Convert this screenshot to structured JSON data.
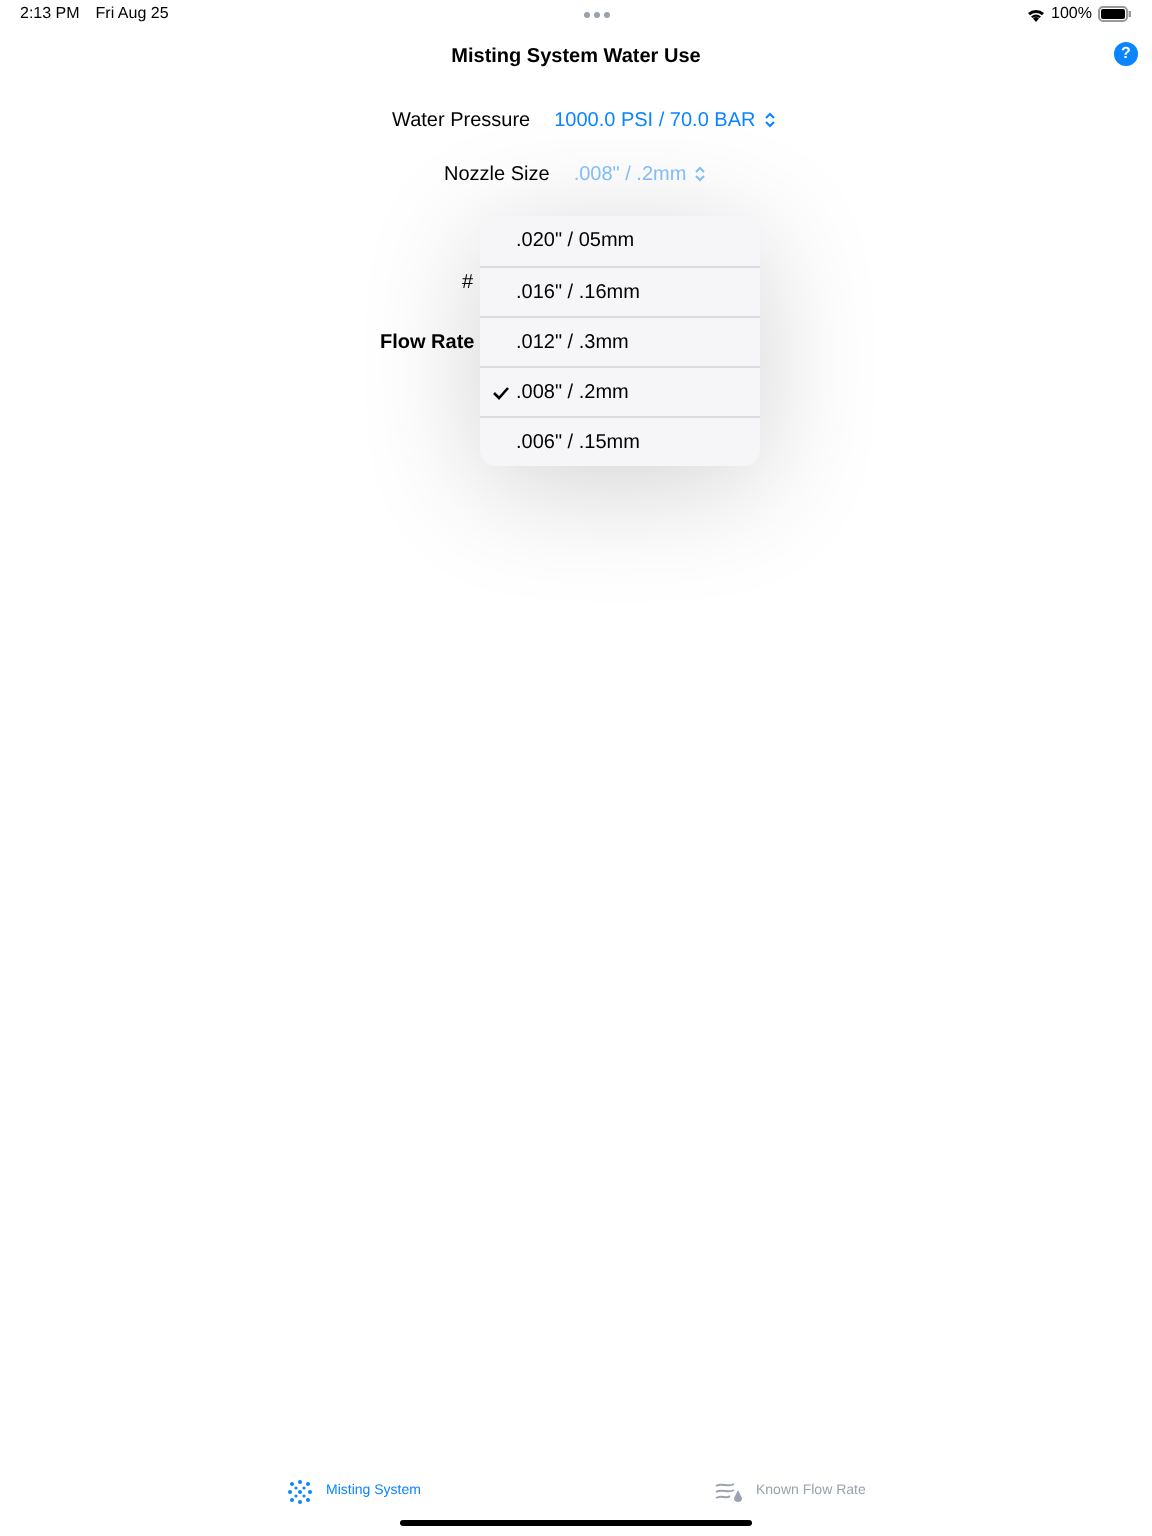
{
  "status_bar": {
    "time": "2:13 PM",
    "date": "Fri Aug 25",
    "battery": "100%"
  },
  "nav": {
    "title": "Misting System Water Use",
    "help": "?"
  },
  "fields": [
    {
      "label": "Water Pressure",
      "value": "1000.0 PSI / 70.0 BAR",
      "dimmed": false
    },
    {
      "label": "Nozzle Size",
      "value": ".008\" / .2mm",
      "dimmed": true
    }
  ],
  "hidden_labels": [
    {
      "text": "#",
      "bold": false
    },
    {
      "text": "Flow Rate",
      "bold": true
    }
  ],
  "menu": [
    {
      "label": ".020\" / 05mm",
      "selected": false
    },
    {
      "label": ".016\" / .16mm",
      "selected": false
    },
    {
      "label": ".012\" / .3mm",
      "selected": false
    },
    {
      "label": ".008\" / .2mm",
      "selected": true
    },
    {
      "label": ".006\" / .15mm",
      "selected": false
    }
  ],
  "tabs": [
    {
      "label": "Misting System",
      "selected": true
    },
    {
      "label": "Known Flow Rate",
      "selected": false
    }
  ]
}
